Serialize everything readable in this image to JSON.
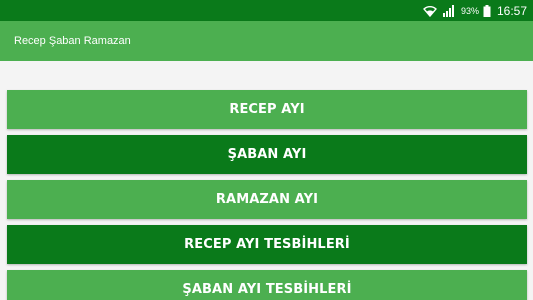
{
  "status_bar": {
    "battery_percent": "93%",
    "time": "16:57",
    "icons": [
      "wifi-icon",
      "signal-icon",
      "battery-icon"
    ]
  },
  "app_bar": {
    "title": "Recep Şaban Ramazan"
  },
  "menu": {
    "items": [
      {
        "label": "RECEP AYI",
        "style": "light"
      },
      {
        "label": "ŞABAN AYI",
        "style": "dark"
      },
      {
        "label": "RAMAZAN AYI",
        "style": "light"
      },
      {
        "label": "RECEP AYI TESBİHLERİ",
        "style": "dark"
      },
      {
        "label": "ŞABAN AYI TESBİHLERİ",
        "style": "light"
      }
    ]
  },
  "colors": {
    "primary": "#4caf50",
    "primary_dark": "#0a7a1a",
    "background": "#f4f4f4"
  }
}
